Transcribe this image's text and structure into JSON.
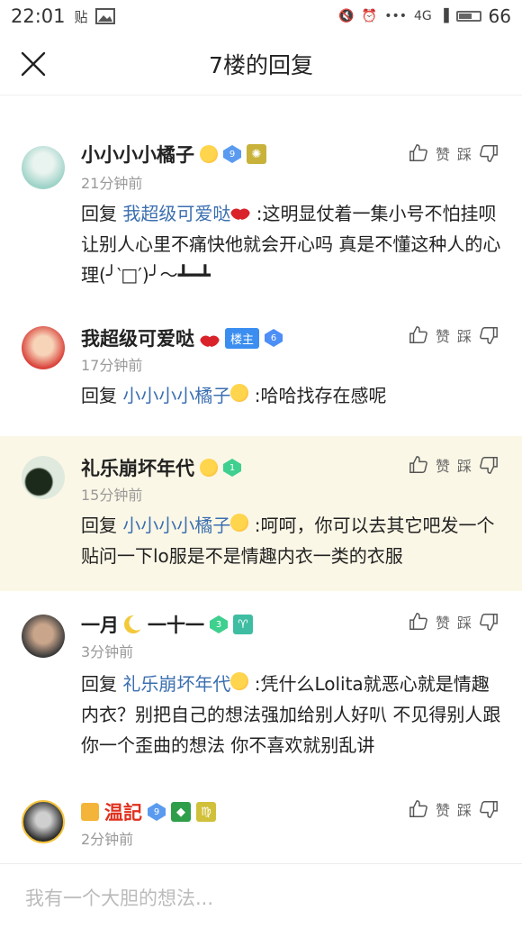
{
  "status": {
    "time": "22:01",
    "left_icons": [
      "贴",
      "image-icon"
    ],
    "network": "4G",
    "battery": "66"
  },
  "header": {
    "title": "7楼的回复"
  },
  "comments": [
    {
      "user": "小小小小橘子",
      "level": "9",
      "time": "21分钟前",
      "reply_label": "回复",
      "reply_to": "我超级可爱哒",
      "text": " :这明显仗着一集小号不怕挂呗 让别人心里不痛快他就会开心吗 真是不懂这种人的心理(╯‵□′)╯～┻━┻",
      "actions": {
        "like": "赞",
        "dislike": "踩"
      }
    },
    {
      "user": "我超级可爱哒",
      "tag": "楼主",
      "level": "6",
      "time": "17分钟前",
      "reply_label": "回复",
      "reply_to": "小小小小橘子",
      "text": " :哈哈找存在感呢",
      "actions": {
        "like": "赞",
        "dislike": "踩"
      }
    },
    {
      "user": "礼乐崩坏年代",
      "level": "1",
      "time": "15分钟前",
      "reply_label": "回复",
      "reply_to": "小小小小橘子",
      "text": " :呵呵，你可以去其它吧发一个贴问一下lo服是不是情趣内衣一类的衣服",
      "actions": {
        "like": "赞",
        "dislike": "踩"
      }
    },
    {
      "user": "一月",
      "user_suffix": "一十一",
      "level": "3",
      "zodiac": "♈",
      "time": "3分钟前",
      "reply_label": "回复",
      "reply_to": "礼乐崩坏年代",
      "text": " :凭什么Lolita就恶心就是情趣内衣？别把自己的想法强加给别人好叭 不见得别人跟你一个歪曲的想法 你不喜欢就别乱讲",
      "actions": {
        "like": "赞",
        "dislike": "踩"
      }
    },
    {
      "user": "温記",
      "level": "9",
      "zodiac": "♍",
      "time": "2分钟前",
      "actions": {
        "like": "赞",
        "dislike": "踩"
      }
    }
  ],
  "bottom": {
    "placeholder": "我有一个大胆的想法..."
  },
  "colors": {
    "link": "#3b6fb0",
    "highlight_bg": "#fbf7e6",
    "muted": "#999999"
  }
}
